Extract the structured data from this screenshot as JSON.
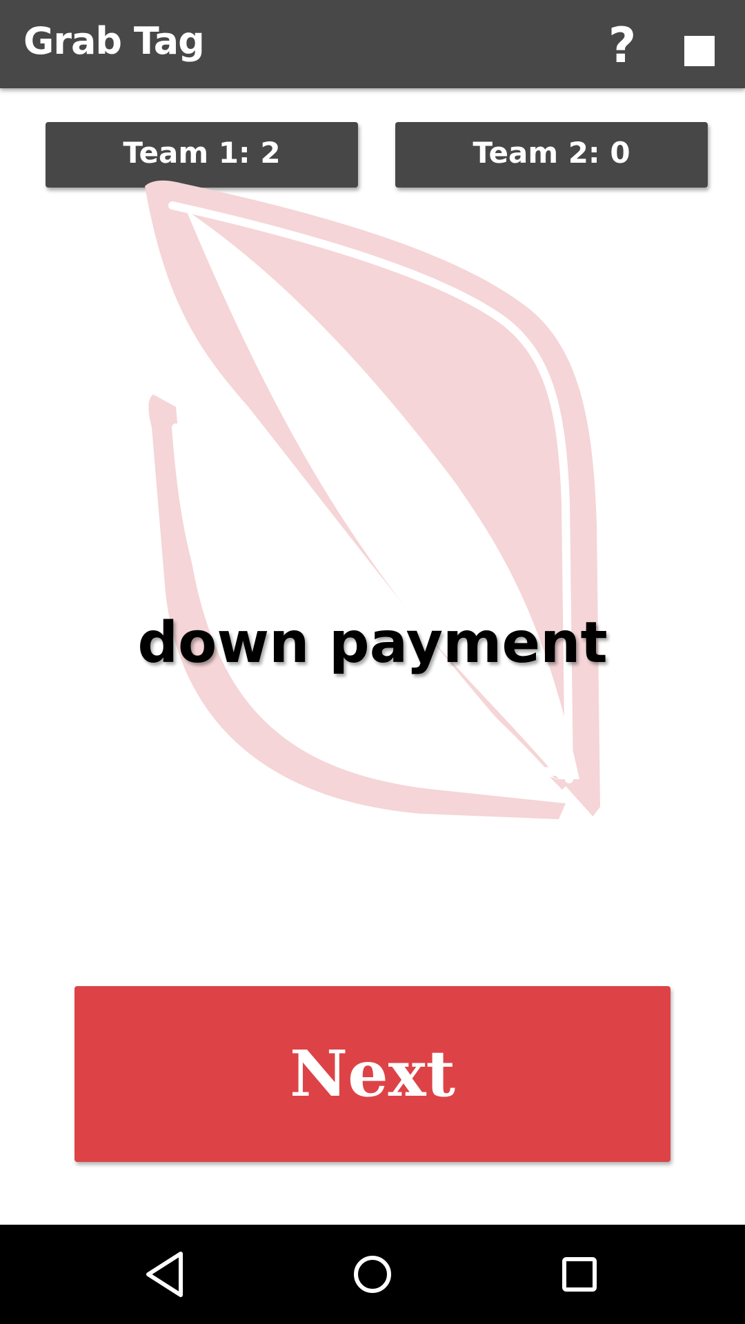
{
  "app_bar": {
    "title": "Grab Tag",
    "help_label": "?",
    "stop_icon": "stop-icon"
  },
  "scores": {
    "team1": "Team 1: 2",
    "team2": "Team 2: 0"
  },
  "card": {
    "word": "down payment",
    "logo_icon": "leaf-logo-icon"
  },
  "actions": {
    "next_label": "Next"
  },
  "nav_bar": {
    "back_icon": "back-icon",
    "home_icon": "home-icon",
    "recents_icon": "recents-icon"
  },
  "colors": {
    "app_bar": "#484848",
    "score_button": "#474747",
    "next_button": "#dd4346",
    "leaf": "#f5d5d7",
    "nav_bar": "#000000"
  }
}
